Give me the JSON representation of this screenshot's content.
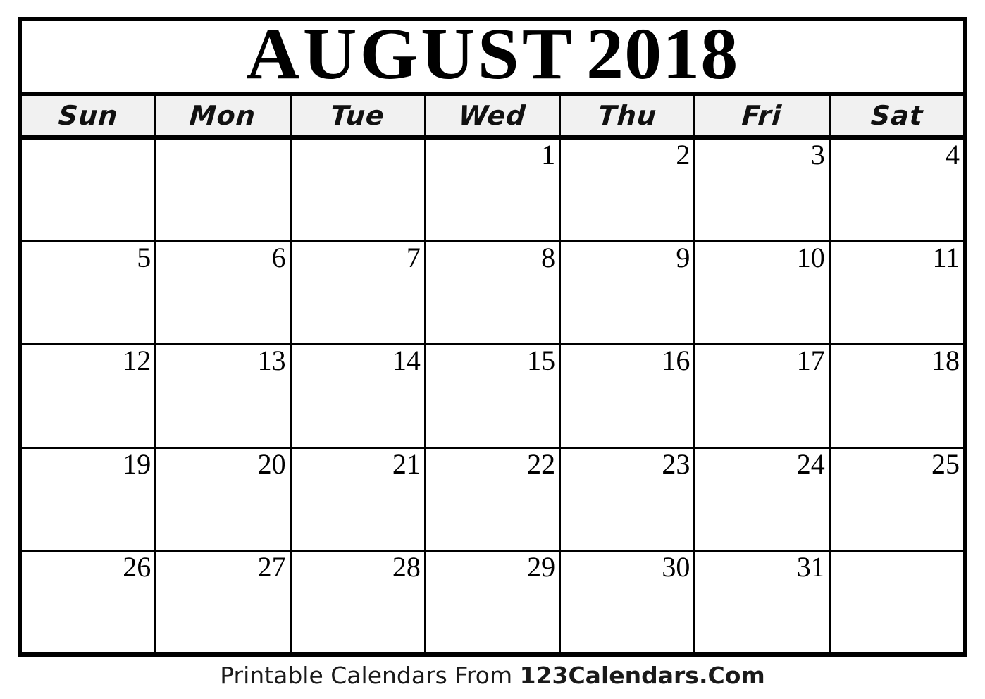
{
  "document": {
    "title": "August 2018 Printable Calendar"
  },
  "header": {
    "month": "AUGUST",
    "year": "2018"
  },
  "weekdays": [
    {
      "label": "Sun"
    },
    {
      "label": "Mon"
    },
    {
      "label": "Tue"
    },
    {
      "label": "Wed"
    },
    {
      "label": "Thu"
    },
    {
      "label": "Fri"
    },
    {
      "label": "Sat"
    }
  ],
  "weeks": [
    {
      "days": [
        {
          "number": ""
        },
        {
          "number": ""
        },
        {
          "number": ""
        },
        {
          "number": "1"
        },
        {
          "number": "2"
        },
        {
          "number": "3"
        },
        {
          "number": "4"
        }
      ]
    },
    {
      "days": [
        {
          "number": "5"
        },
        {
          "number": "6"
        },
        {
          "number": "7"
        },
        {
          "number": "8"
        },
        {
          "number": "9"
        },
        {
          "number": "10"
        },
        {
          "number": "11"
        }
      ]
    },
    {
      "days": [
        {
          "number": "12"
        },
        {
          "number": "13"
        },
        {
          "number": "14"
        },
        {
          "number": "15"
        },
        {
          "number": "16"
        },
        {
          "number": "17"
        },
        {
          "number": "18"
        }
      ]
    },
    {
      "days": [
        {
          "number": "19"
        },
        {
          "number": "20"
        },
        {
          "number": "21"
        },
        {
          "number": "22"
        },
        {
          "number": "23"
        },
        {
          "number": "24"
        },
        {
          "number": "25"
        }
      ]
    },
    {
      "days": [
        {
          "number": "26"
        },
        {
          "number": "27"
        },
        {
          "number": "28"
        },
        {
          "number": "29"
        },
        {
          "number": "30"
        },
        {
          "number": "31"
        },
        {
          "number": ""
        }
      ]
    }
  ],
  "footer": {
    "prefix": "Printable Calendars From ",
    "brand": "123Calendars.Com"
  },
  "colors": {
    "border": "#000000",
    "weekday_header_background": "#f1f1f1",
    "cell_background": "#ffffff",
    "page_background": "#ffffff",
    "text": "#000000"
  }
}
